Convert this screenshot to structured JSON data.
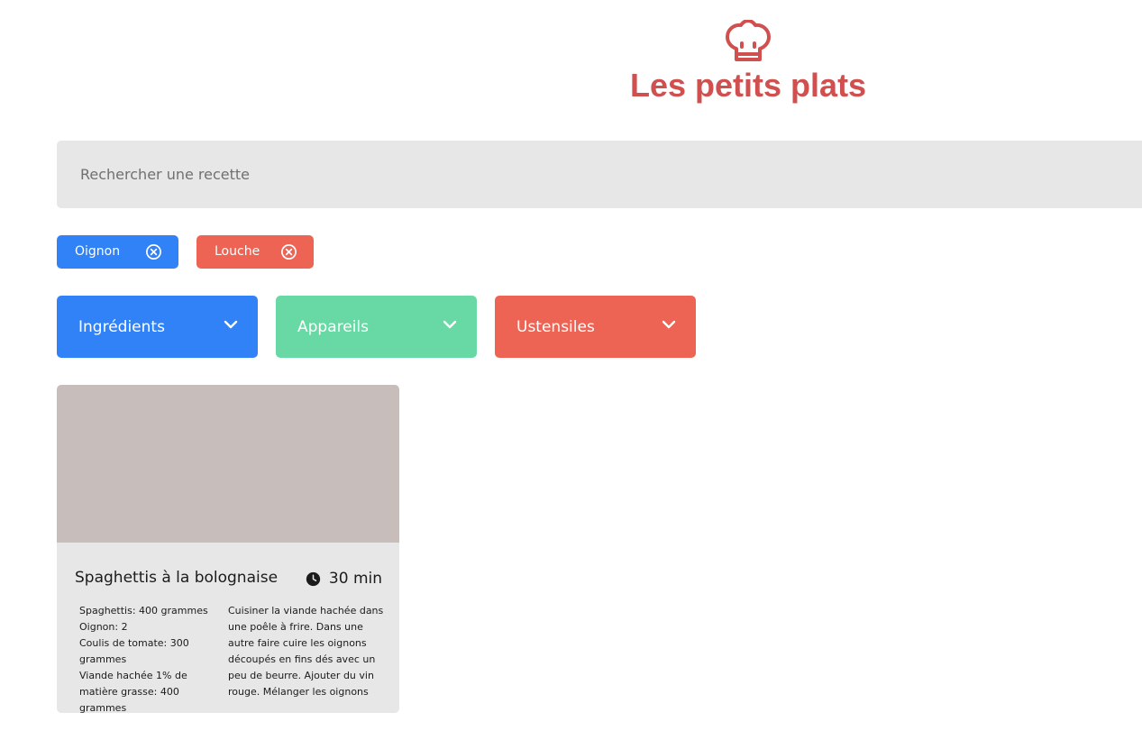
{
  "header": {
    "logo_icon": "chef-hat-icon",
    "title": "Les petits plats"
  },
  "search": {
    "placeholder": "Rechercher une recette",
    "value": ""
  },
  "tags": [
    {
      "label": "Oignon",
      "category": "ingredient",
      "color": "#3282f7",
      "close_icon": "close-circle-icon"
    },
    {
      "label": "Louche",
      "category": "ustensile",
      "color": "#ed6454",
      "close_icon": "close-circle-icon"
    }
  ],
  "filters": [
    {
      "label": "Ingrédients",
      "color": "#3282f7",
      "icon": "chevron-down-icon"
    },
    {
      "label": "Appareils",
      "color": "#68d9a4",
      "icon": "chevron-down-icon"
    },
    {
      "label": "Ustensiles",
      "color": "#ed6454",
      "icon": "chevron-down-icon"
    }
  ],
  "recipes": [
    {
      "title": "Spaghettis à la bolognaise",
      "time": "30 min",
      "time_icon": "clock-icon",
      "ingredients": [
        "Spaghettis: 400 grammes",
        "Oignon: 2",
        "Coulis de tomate: 300 grammes",
        "Viande hachée 1% de matière grasse: 400 grammes"
      ],
      "description": "Cuisiner la viande hachée dans une poêle à frire. Dans une autre faire cuire les oignons découpés en fins dés avec un peu de beurre. Ajouter du vin rouge. Mélanger les oignons avec la"
    }
  ],
  "colors": {
    "title": "#d04f4f",
    "search_bg": "#e7e7e7",
    "card_image": "#c7bebb"
  }
}
